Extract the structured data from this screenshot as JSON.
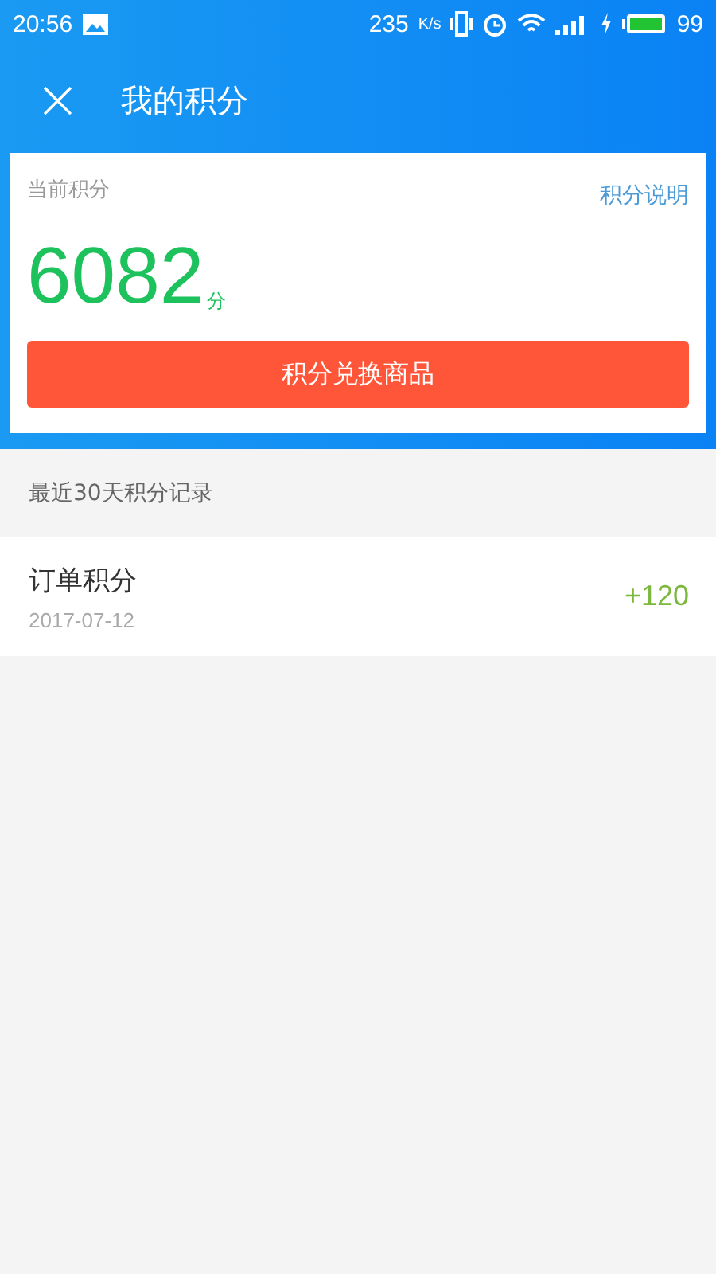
{
  "status_bar": {
    "time": "20:56",
    "speed": "235",
    "speed_unit": "K/s",
    "battery": "99"
  },
  "app_bar": {
    "close": "×",
    "title": "我的积分"
  },
  "points_card": {
    "label": "当前积分",
    "help_link": "积分说明",
    "points": "6082",
    "unit": "分",
    "button": "积分兑换商品"
  },
  "history": {
    "heading": "最近30天积分记录",
    "records": [
      {
        "title": "订单积分",
        "date": "2017-07-12",
        "amount": "+120"
      }
    ]
  }
}
